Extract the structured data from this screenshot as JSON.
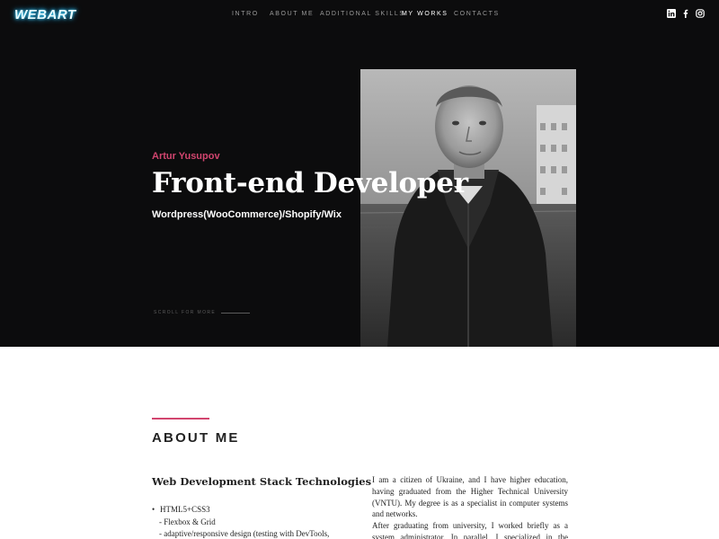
{
  "brand": {
    "logo": "WEBART"
  },
  "nav": {
    "items": [
      {
        "label": "INTRO"
      },
      {
        "label": "ABOUT ME"
      },
      {
        "label": "ADDITIONAL SKILLS"
      },
      {
        "label": "MY WORKS",
        "active": true
      },
      {
        "label": "CONTACTS"
      }
    ]
  },
  "social": {
    "icons": [
      "linkedin-icon",
      "facebook-icon",
      "instagram-icon"
    ]
  },
  "hero": {
    "name": "Artur Yusupov",
    "title": "Front-end Developer",
    "subtitle": "Wordpress(WooCommerce)/Shopify/Wix",
    "scroll_label": "SCROLL FOR MORE"
  },
  "about": {
    "heading": "ABOUT ME",
    "stack_title": "Web Development Stack Technologies",
    "stack_list": [
      "HTML5+CSS3",
      "- Flexbox & Grid",
      "- adaptive/responsive design (testing with DevTools,"
    ],
    "paragraph_1": "I am a citizen of Ukraine, and I have higher education, having graduated from the Higher Technical University (VNTU). My degree is as a specialist in computer systems and networks.",
    "paragraph_2": "After graduating from university, I worked briefly as a system administrator. In parallel, I specialized in the development of"
  },
  "colors": {
    "accent": "#d2456f",
    "hero_bg": "#0c0c0d",
    "logo_glow": "#3fd6ff"
  }
}
